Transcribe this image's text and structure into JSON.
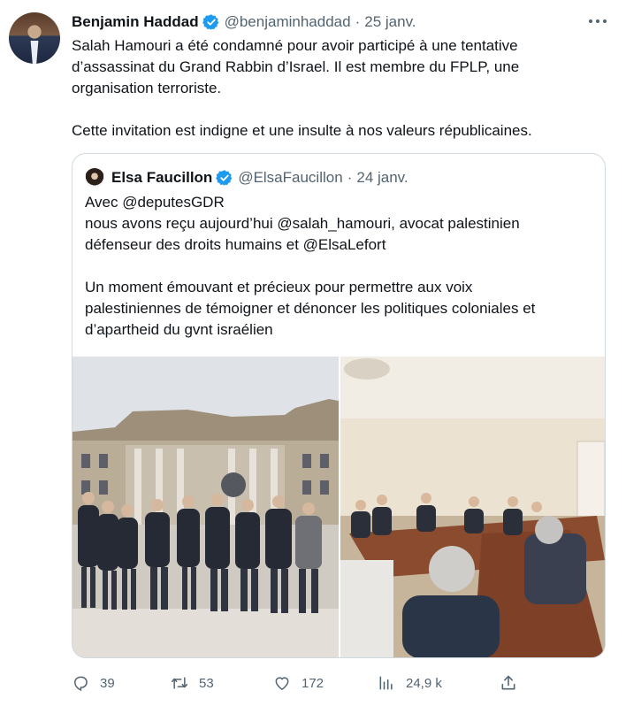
{
  "tweet": {
    "author_name": "Benjamin Haddad",
    "author_handle": "@benjaminhaddad",
    "separator": "·",
    "date": "25 janv.",
    "text_lines": [
      "Salah Hamouri a été condamné pour avoir participé à une tentative",
      "d’assassinat du Grand Rabbin d’Israel. Il est membre du FPLP, une",
      "organisation terroriste."
    ],
    "text_paragraph_2": "Cette invitation est indigne et une insulte à nos valeurs républicaines."
  },
  "quoted_tweet": {
    "author_name": "Elsa Faucillon",
    "author_handle": "@ElsaFaucillon",
    "separator": "·",
    "date": "24 janv.",
    "text_lines_1": [
      "Avec @deputesGDR",
      "nous avons reçu aujourd’hui @salah_hamouri, avocat palestinien",
      "défenseur des droits humains et @ElsaLefort"
    ],
    "text_lines_2": [
      "Un moment émouvant et précieux pour permettre aux voix",
      "palestiniennes de témoigner et dénoncer les politiques coloniales et",
      "d’apartheid du gvnt israélien"
    ]
  },
  "actions": {
    "replies": "39",
    "retweets": "53",
    "likes": "172",
    "views": "24,9 k"
  },
  "icons": {
    "verified": "verified-badge-icon",
    "more": "more-options-icon",
    "reply": "reply-icon",
    "retweet": "retweet-icon",
    "like": "heart-icon",
    "views": "views-icon",
    "share": "share-icon"
  },
  "colors": {
    "verified": "#1d9bf0",
    "text": "#0f1419",
    "secondary": "#536471",
    "border": "#cfd9de"
  }
}
